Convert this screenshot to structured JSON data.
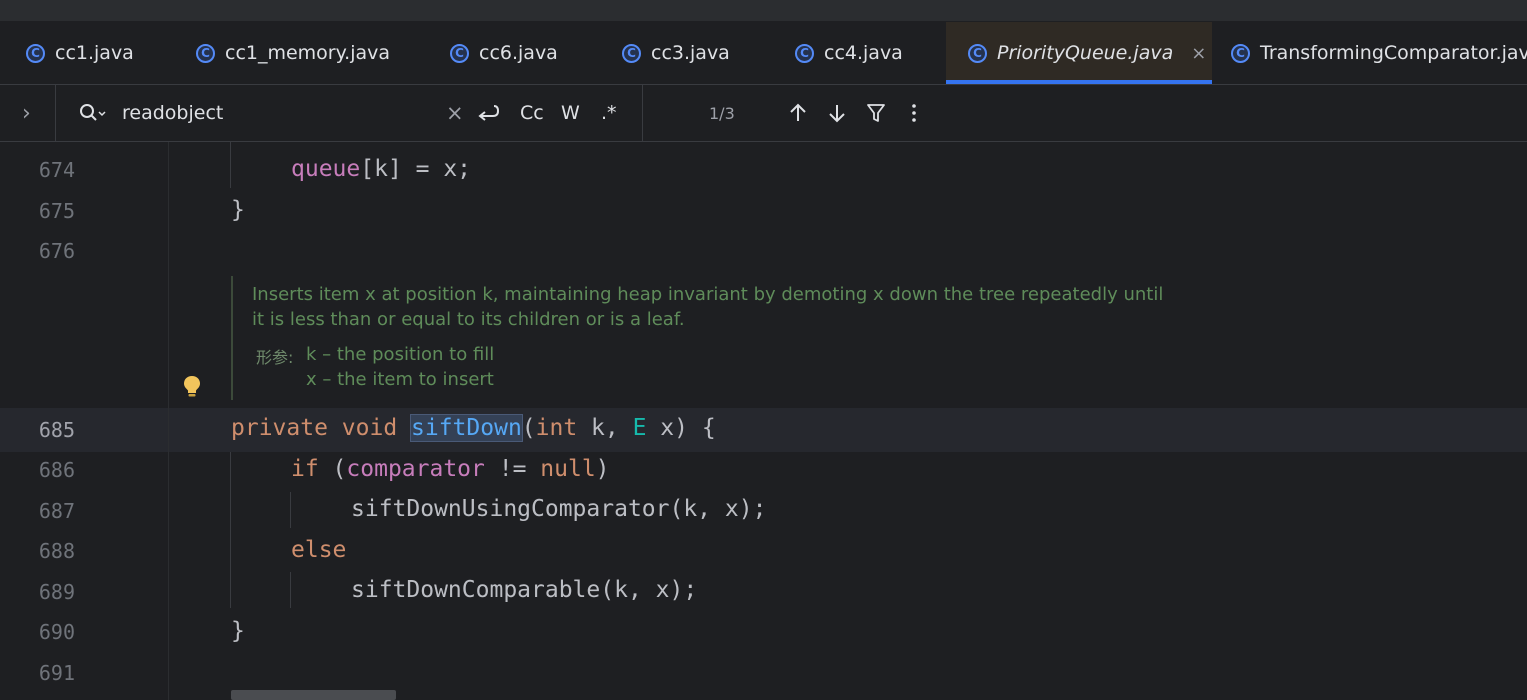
{
  "tabs": [
    {
      "label": "cc1.java",
      "active": false
    },
    {
      "label": "cc1_memory.java",
      "active": false
    },
    {
      "label": "cc6.java",
      "active": false
    },
    {
      "label": "cc3.java",
      "active": false
    },
    {
      "label": "cc4.java",
      "active": false
    },
    {
      "label": "PriorityQueue.java",
      "active": true
    },
    {
      "label": "TransformingComparator.java",
      "active": false
    }
  ],
  "tab_icon_glyph": "C",
  "tab_close_glyph": "×",
  "search": {
    "query": "readobject",
    "match_count": "1/3",
    "match_case_label": "Cc",
    "words_label": "W",
    "regex_label": ".*",
    "clear_glyph": "×",
    "expand_glyph": "›"
  },
  "code": {
    "line_numbers": [
      "674",
      "675",
      "676",
      "685",
      "686",
      "687",
      "688",
      "689",
      "690",
      "691"
    ],
    "current_line": "685"
  },
  "doc": {
    "line1": "Inserts item x at position k, maintaining heap invariant by demoting x down the tree repeatedly until",
    "line2": "it is less than or equal to its children or is a leaf.",
    "params_label": "形参:",
    "param1": "k – the position to fill",
    "param2": "x – the item to insert"
  },
  "colors": {
    "accent": "#3574f0",
    "keyword": "#cf8e6d",
    "field": "#c77dbb",
    "method": "#56a8f5",
    "type_param": "#16baac",
    "doc_comment": "#5f8c5a"
  }
}
